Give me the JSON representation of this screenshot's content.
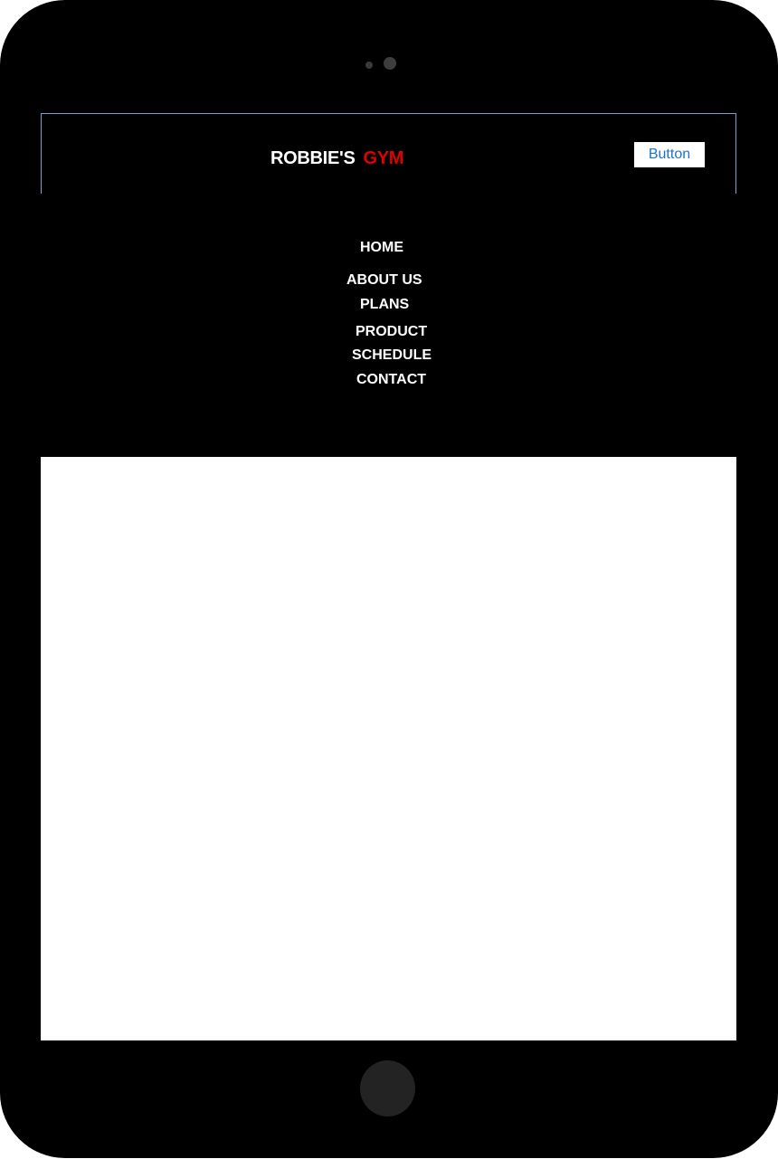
{
  "header": {
    "brand_main": "ROBBIE'S",
    "brand_accent": "GYM",
    "button_label": "Button"
  },
  "nav": {
    "items": [
      {
        "label": "HOME"
      },
      {
        "label": "ABOUT US"
      },
      {
        "label": "PLANS"
      },
      {
        "label": "PRODUCT"
      },
      {
        "label": "SCHEDULE"
      },
      {
        "label": "CONTACT"
      }
    ]
  },
  "colors": {
    "background": "#000000",
    "brand_accent": "#e00000",
    "button_text": "#1a73c8",
    "content": "#ffffff"
  }
}
